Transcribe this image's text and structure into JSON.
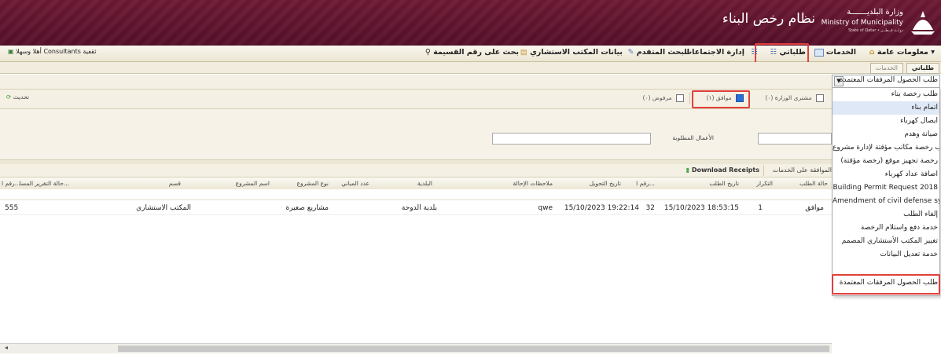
{
  "header": {
    "system_title": "نظام رخص البناء",
    "logo_ar": "وزارة البلديـــــــة",
    "logo_en": "Ministry of Municipality",
    "logo_small": "State of Qatar • دولــة قــطــر"
  },
  "menubar": {
    "general_info": "معلومات عامة",
    "services": "الخدمات",
    "my_requests": "طلباتي",
    "meetings_admin": "إدارة الاجتماعات",
    "advanced_search": "البحث المتقدم",
    "consultant_data": "بيانات المكتب الاستشاري",
    "search_by_plot": "بحث على رقم القسيمة",
    "user_label": "أهلا وسهلا Consultants ثقفية"
  },
  "tabs": {
    "my_requests_tab": "طلباتي",
    "services_tab": "الخدمات"
  },
  "toolbar": {
    "chk_ministry_review": "مشترى الوزارة (٠)",
    "chk_approved": "موافق (١)",
    "chk_rejected": "مرفوض (٠)",
    "refresh": "تحديث"
  },
  "filter": {
    "required_works_label": "الأعمال المطلوبة"
  },
  "grid": {
    "actions": {
      "approve_services": "الموافقة على الخدمات",
      "download_receipts": "Download Receipts"
    },
    "columns": [
      "حالة الطلب",
      "التكرار",
      "تاريخ الطلب",
      "رقم ا...",
      "تاريخ التحويل",
      "ملاحظات الإحالة",
      "البلدية",
      "عدد المباني",
      "نوع المشروع",
      "اسم المشروع",
      "قسم",
      "حالة التقرير المسا...",
      "رقم ا..."
    ],
    "rows": [
      {
        "status": "موافق",
        "repeat": "1",
        "request_date": "15/10/2023 18:53:15",
        "num": "32",
        "transfer_date": "15/10/2023 19:22:14",
        "transfer_notes": "qwe",
        "municipality": "بلدية الدوحة",
        "buildings": "",
        "project_type": "مشاريع صغيرة",
        "project_name": "",
        "department": "المكتب الاستشاري",
        "report_status": "",
        "plot_num": "555"
      }
    ]
  },
  "dropdown": {
    "selected": "طلب الحصول المرفقات المعتمدة",
    "options": [
      "طلب رخصة بناء",
      "اتمام بناء",
      "ايصال كهرباء",
      "صيانة وهدم",
      "طلب رخصة مكاتب مؤقتة لإدارة مشروع",
      "رخصة تجهيز موقع (رخصة مؤقتة)",
      "اضافة عداد كهرباء",
      "Building Permit Request 2018",
      "Amendment of civil defense syste...",
      "إلغاء الطلب",
      "خدمة دفع واستلام الرخصة",
      "تغيير المكتب الأستشاري المصمم",
      "خدمة تعديل البيانات",
      "طلب الحصول المرفقات المعتمدة"
    ]
  },
  "colors": {
    "header_bg": "#5e1530",
    "highlight": "#e0403a",
    "check_blue": "#2a6fd6"
  }
}
